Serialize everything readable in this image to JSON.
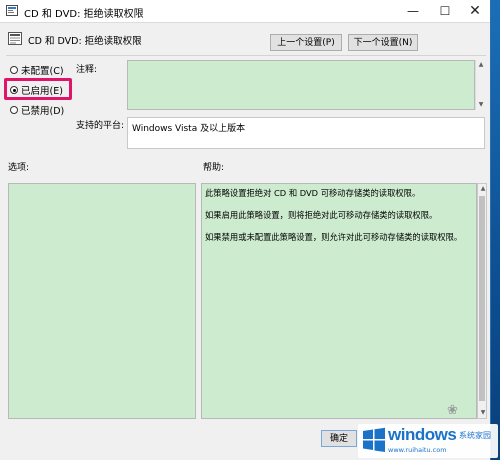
{
  "window": {
    "title": "CD 和 DVD: 拒绝读取权限",
    "minimize_glyph": "—",
    "maximize_glyph": "☐",
    "close_glyph": "✕"
  },
  "header": {
    "title": "CD 和 DVD: 拒绝读取权限",
    "prev_button": "上一个设置(P)",
    "next_button": "下一个设置(N)"
  },
  "radios": [
    {
      "label": "未配置(C)",
      "checked": false
    },
    {
      "label": "已启用(E)",
      "checked": true
    },
    {
      "label": "已禁用(D)",
      "checked": false
    }
  ],
  "fields": {
    "comment_label": "注释:",
    "comment_value": "",
    "platform_label": "支持的平台:",
    "platform_value": "Windows Vista 及以上版本"
  },
  "sections": {
    "options_label": "选项:",
    "help_label": "帮助:"
  },
  "help_text": [
    "此策略设置拒绝对 CD 和 DVD 可移动存储类的读取权限。",
    "如果启用此策略设置，则将拒绝对此可移动存储类的读取权限。",
    "如果禁用或未配置此策略设置，则允许对此可移动存储类的读取权限。"
  ],
  "footer": {
    "ok_button": "确定"
  },
  "watermark": {
    "brand": "windows",
    "suffix": "系统家园",
    "url": "www.ruihaitu.com"
  },
  "colors": {
    "green_field": "#cdeccf",
    "highlight": "#e0156a",
    "watermark_blue": "#1a73c8"
  }
}
